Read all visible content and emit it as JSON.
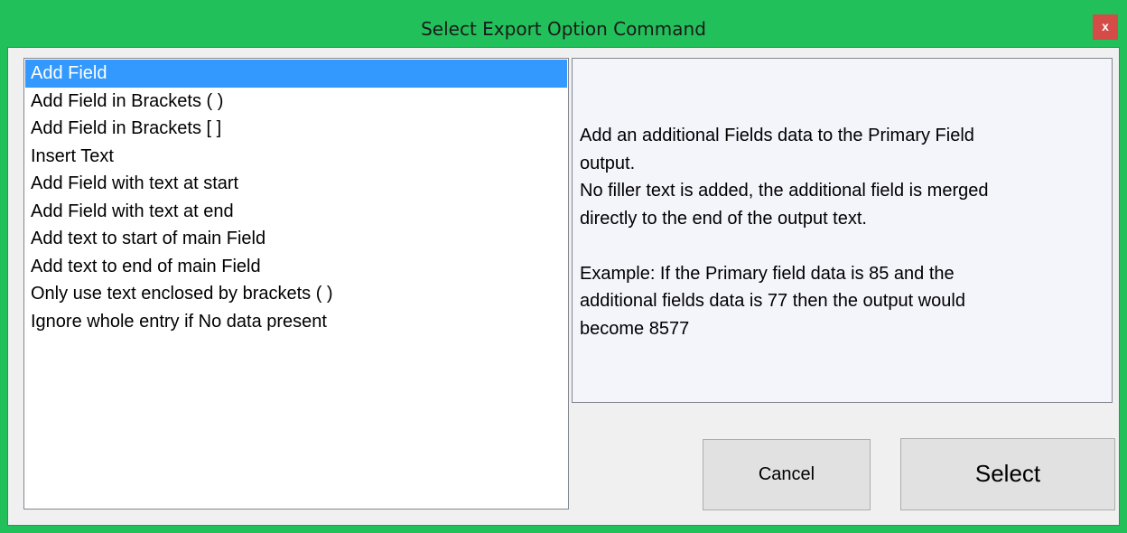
{
  "window": {
    "title": "Select Export Option Command",
    "close_label": "x",
    "frame_color": "#22c05a",
    "close_color": "#d44b47"
  },
  "options": {
    "selected_index": 0,
    "selection_color": "#3399ff",
    "items": [
      {
        "label": "Add Field"
      },
      {
        "label": "Add Field in Brackets ( )"
      },
      {
        "label": "Add Field in Brackets [ ]"
      },
      {
        "label": "Insert Text"
      },
      {
        "label": "Add Field with text at start"
      },
      {
        "label": "Add Field with text at end"
      },
      {
        "label": "Add text to start of main Field"
      },
      {
        "label": "Add text to end of main Field"
      },
      {
        "label": "Only use text enclosed by brackets ( )"
      },
      {
        "label": "Ignore whole entry if No data present"
      }
    ]
  },
  "description": {
    "lines": [
      "Add an additional Fields data to the Primary Field",
      "output.",
      "No filler text is added, the additional field is merged",
      "directly to the end of the output text.",
      "",
      "Example: If the Primary field data is 85 and the",
      "additional fields data is 77 then the output would",
      "become 8577"
    ]
  },
  "buttons": {
    "cancel_label": "Cancel",
    "select_label": "Select"
  }
}
